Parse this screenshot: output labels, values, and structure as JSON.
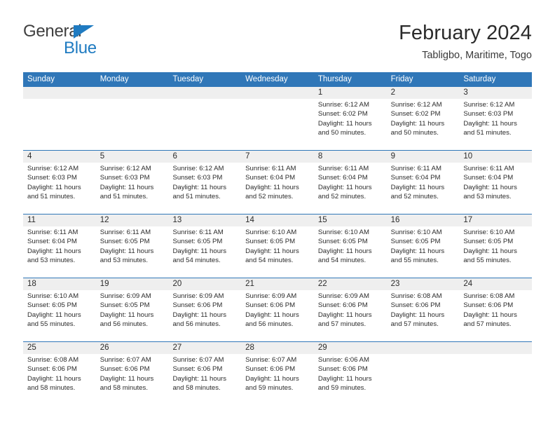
{
  "brand": {
    "name_part1": "General",
    "name_part2": "Blue",
    "triangle_color": "#1f7bc1"
  },
  "header": {
    "title": "February 2024",
    "subtitle": "Tabligbo, Maritime, Togo"
  },
  "theme": {
    "header_blue": "#3077b8",
    "date_strip_gray": "#efefef",
    "text_color": "#2b2b2b"
  },
  "calendar": {
    "weekdays": [
      "Sunday",
      "Monday",
      "Tuesday",
      "Wednesday",
      "Thursday",
      "Friday",
      "Saturday"
    ],
    "weeks": [
      [
        {
          "day": "",
          "sunrise": "",
          "sunset": "",
          "daylight": ""
        },
        {
          "day": "",
          "sunrise": "",
          "sunset": "",
          "daylight": ""
        },
        {
          "day": "",
          "sunrise": "",
          "sunset": "",
          "daylight": ""
        },
        {
          "day": "",
          "sunrise": "",
          "sunset": "",
          "daylight": ""
        },
        {
          "day": "1",
          "sunrise": "Sunrise: 6:12 AM",
          "sunset": "Sunset: 6:02 PM",
          "daylight": "Daylight: 11 hours and 50 minutes."
        },
        {
          "day": "2",
          "sunrise": "Sunrise: 6:12 AM",
          "sunset": "Sunset: 6:02 PM",
          "daylight": "Daylight: 11 hours and 50 minutes."
        },
        {
          "day": "3",
          "sunrise": "Sunrise: 6:12 AM",
          "sunset": "Sunset: 6:03 PM",
          "daylight": "Daylight: 11 hours and 51 minutes."
        }
      ],
      [
        {
          "day": "4",
          "sunrise": "Sunrise: 6:12 AM",
          "sunset": "Sunset: 6:03 PM",
          "daylight": "Daylight: 11 hours and 51 minutes."
        },
        {
          "day": "5",
          "sunrise": "Sunrise: 6:12 AM",
          "sunset": "Sunset: 6:03 PM",
          "daylight": "Daylight: 11 hours and 51 minutes."
        },
        {
          "day": "6",
          "sunrise": "Sunrise: 6:12 AM",
          "sunset": "Sunset: 6:03 PM",
          "daylight": "Daylight: 11 hours and 51 minutes."
        },
        {
          "day": "7",
          "sunrise": "Sunrise: 6:11 AM",
          "sunset": "Sunset: 6:04 PM",
          "daylight": "Daylight: 11 hours and 52 minutes."
        },
        {
          "day": "8",
          "sunrise": "Sunrise: 6:11 AM",
          "sunset": "Sunset: 6:04 PM",
          "daylight": "Daylight: 11 hours and 52 minutes."
        },
        {
          "day": "9",
          "sunrise": "Sunrise: 6:11 AM",
          "sunset": "Sunset: 6:04 PM",
          "daylight": "Daylight: 11 hours and 52 minutes."
        },
        {
          "day": "10",
          "sunrise": "Sunrise: 6:11 AM",
          "sunset": "Sunset: 6:04 PM",
          "daylight": "Daylight: 11 hours and 53 minutes."
        }
      ],
      [
        {
          "day": "11",
          "sunrise": "Sunrise: 6:11 AM",
          "sunset": "Sunset: 6:04 PM",
          "daylight": "Daylight: 11 hours and 53 minutes."
        },
        {
          "day": "12",
          "sunrise": "Sunrise: 6:11 AM",
          "sunset": "Sunset: 6:05 PM",
          "daylight": "Daylight: 11 hours and 53 minutes."
        },
        {
          "day": "13",
          "sunrise": "Sunrise: 6:11 AM",
          "sunset": "Sunset: 6:05 PM",
          "daylight": "Daylight: 11 hours and 54 minutes."
        },
        {
          "day": "14",
          "sunrise": "Sunrise: 6:10 AM",
          "sunset": "Sunset: 6:05 PM",
          "daylight": "Daylight: 11 hours and 54 minutes."
        },
        {
          "day": "15",
          "sunrise": "Sunrise: 6:10 AM",
          "sunset": "Sunset: 6:05 PM",
          "daylight": "Daylight: 11 hours and 54 minutes."
        },
        {
          "day": "16",
          "sunrise": "Sunrise: 6:10 AM",
          "sunset": "Sunset: 6:05 PM",
          "daylight": "Daylight: 11 hours and 55 minutes."
        },
        {
          "day": "17",
          "sunrise": "Sunrise: 6:10 AM",
          "sunset": "Sunset: 6:05 PM",
          "daylight": "Daylight: 11 hours and 55 minutes."
        }
      ],
      [
        {
          "day": "18",
          "sunrise": "Sunrise: 6:10 AM",
          "sunset": "Sunset: 6:05 PM",
          "daylight": "Daylight: 11 hours and 55 minutes."
        },
        {
          "day": "19",
          "sunrise": "Sunrise: 6:09 AM",
          "sunset": "Sunset: 6:05 PM",
          "daylight": "Daylight: 11 hours and 56 minutes."
        },
        {
          "day": "20",
          "sunrise": "Sunrise: 6:09 AM",
          "sunset": "Sunset: 6:06 PM",
          "daylight": "Daylight: 11 hours and 56 minutes."
        },
        {
          "day": "21",
          "sunrise": "Sunrise: 6:09 AM",
          "sunset": "Sunset: 6:06 PM",
          "daylight": "Daylight: 11 hours and 56 minutes."
        },
        {
          "day": "22",
          "sunrise": "Sunrise: 6:09 AM",
          "sunset": "Sunset: 6:06 PM",
          "daylight": "Daylight: 11 hours and 57 minutes."
        },
        {
          "day": "23",
          "sunrise": "Sunrise: 6:08 AM",
          "sunset": "Sunset: 6:06 PM",
          "daylight": "Daylight: 11 hours and 57 minutes."
        },
        {
          "day": "24",
          "sunrise": "Sunrise: 6:08 AM",
          "sunset": "Sunset: 6:06 PM",
          "daylight": "Daylight: 11 hours and 57 minutes."
        }
      ],
      [
        {
          "day": "25",
          "sunrise": "Sunrise: 6:08 AM",
          "sunset": "Sunset: 6:06 PM",
          "daylight": "Daylight: 11 hours and 58 minutes."
        },
        {
          "day": "26",
          "sunrise": "Sunrise: 6:07 AM",
          "sunset": "Sunset: 6:06 PM",
          "daylight": "Daylight: 11 hours and 58 minutes."
        },
        {
          "day": "27",
          "sunrise": "Sunrise: 6:07 AM",
          "sunset": "Sunset: 6:06 PM",
          "daylight": "Daylight: 11 hours and 58 minutes."
        },
        {
          "day": "28",
          "sunrise": "Sunrise: 6:07 AM",
          "sunset": "Sunset: 6:06 PM",
          "daylight": "Daylight: 11 hours and 59 minutes."
        },
        {
          "day": "29",
          "sunrise": "Sunrise: 6:06 AM",
          "sunset": "Sunset: 6:06 PM",
          "daylight": "Daylight: 11 hours and 59 minutes."
        },
        {
          "day": "",
          "sunrise": "",
          "sunset": "",
          "daylight": ""
        },
        {
          "day": "",
          "sunrise": "",
          "sunset": "",
          "daylight": ""
        }
      ]
    ]
  }
}
